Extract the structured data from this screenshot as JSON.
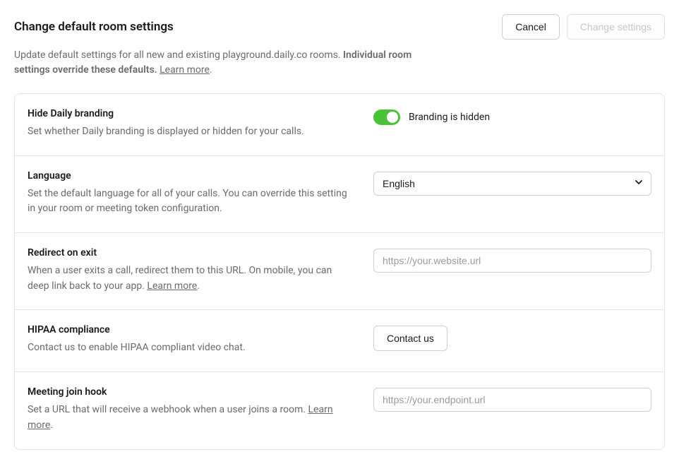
{
  "header": {
    "title": "Change default room settings",
    "cancel_label": "Cancel",
    "change_label": "Change settings"
  },
  "subtitle": {
    "prefix": "Update default settings for all new and existing playground.daily.co rooms. ",
    "bold": "Individual room settings override these defaults.",
    "learn_more": "Learn more",
    "suffix": "."
  },
  "settings": {
    "branding": {
      "title": "Hide Daily branding",
      "desc": "Set whether Daily branding is displayed or hidden for your calls.",
      "toggle_label": "Branding is hidden"
    },
    "language": {
      "title": "Language",
      "desc": "Set the default language for all of your calls. You can override this setting in your room or meeting token configuration.",
      "value": "English"
    },
    "redirect": {
      "title": "Redirect on exit",
      "desc_prefix": "When a user exits a call, redirect them to this URL. On mobile, you can deep link back to your app. ",
      "learn_more": "Learn more",
      "desc_suffix": ".",
      "placeholder": "https://your.website.url"
    },
    "hipaa": {
      "title": "HIPAA compliance",
      "desc": "Contact us to enable HIPAA compliant video chat.",
      "button": "Contact us"
    },
    "webhook": {
      "title": "Meeting join hook",
      "desc_prefix": "Set a URL that will receive a webhook when a user joins a room. ",
      "learn_more": "Learn more",
      "desc_suffix": ".",
      "placeholder": "https://your.endpoint.url"
    }
  }
}
